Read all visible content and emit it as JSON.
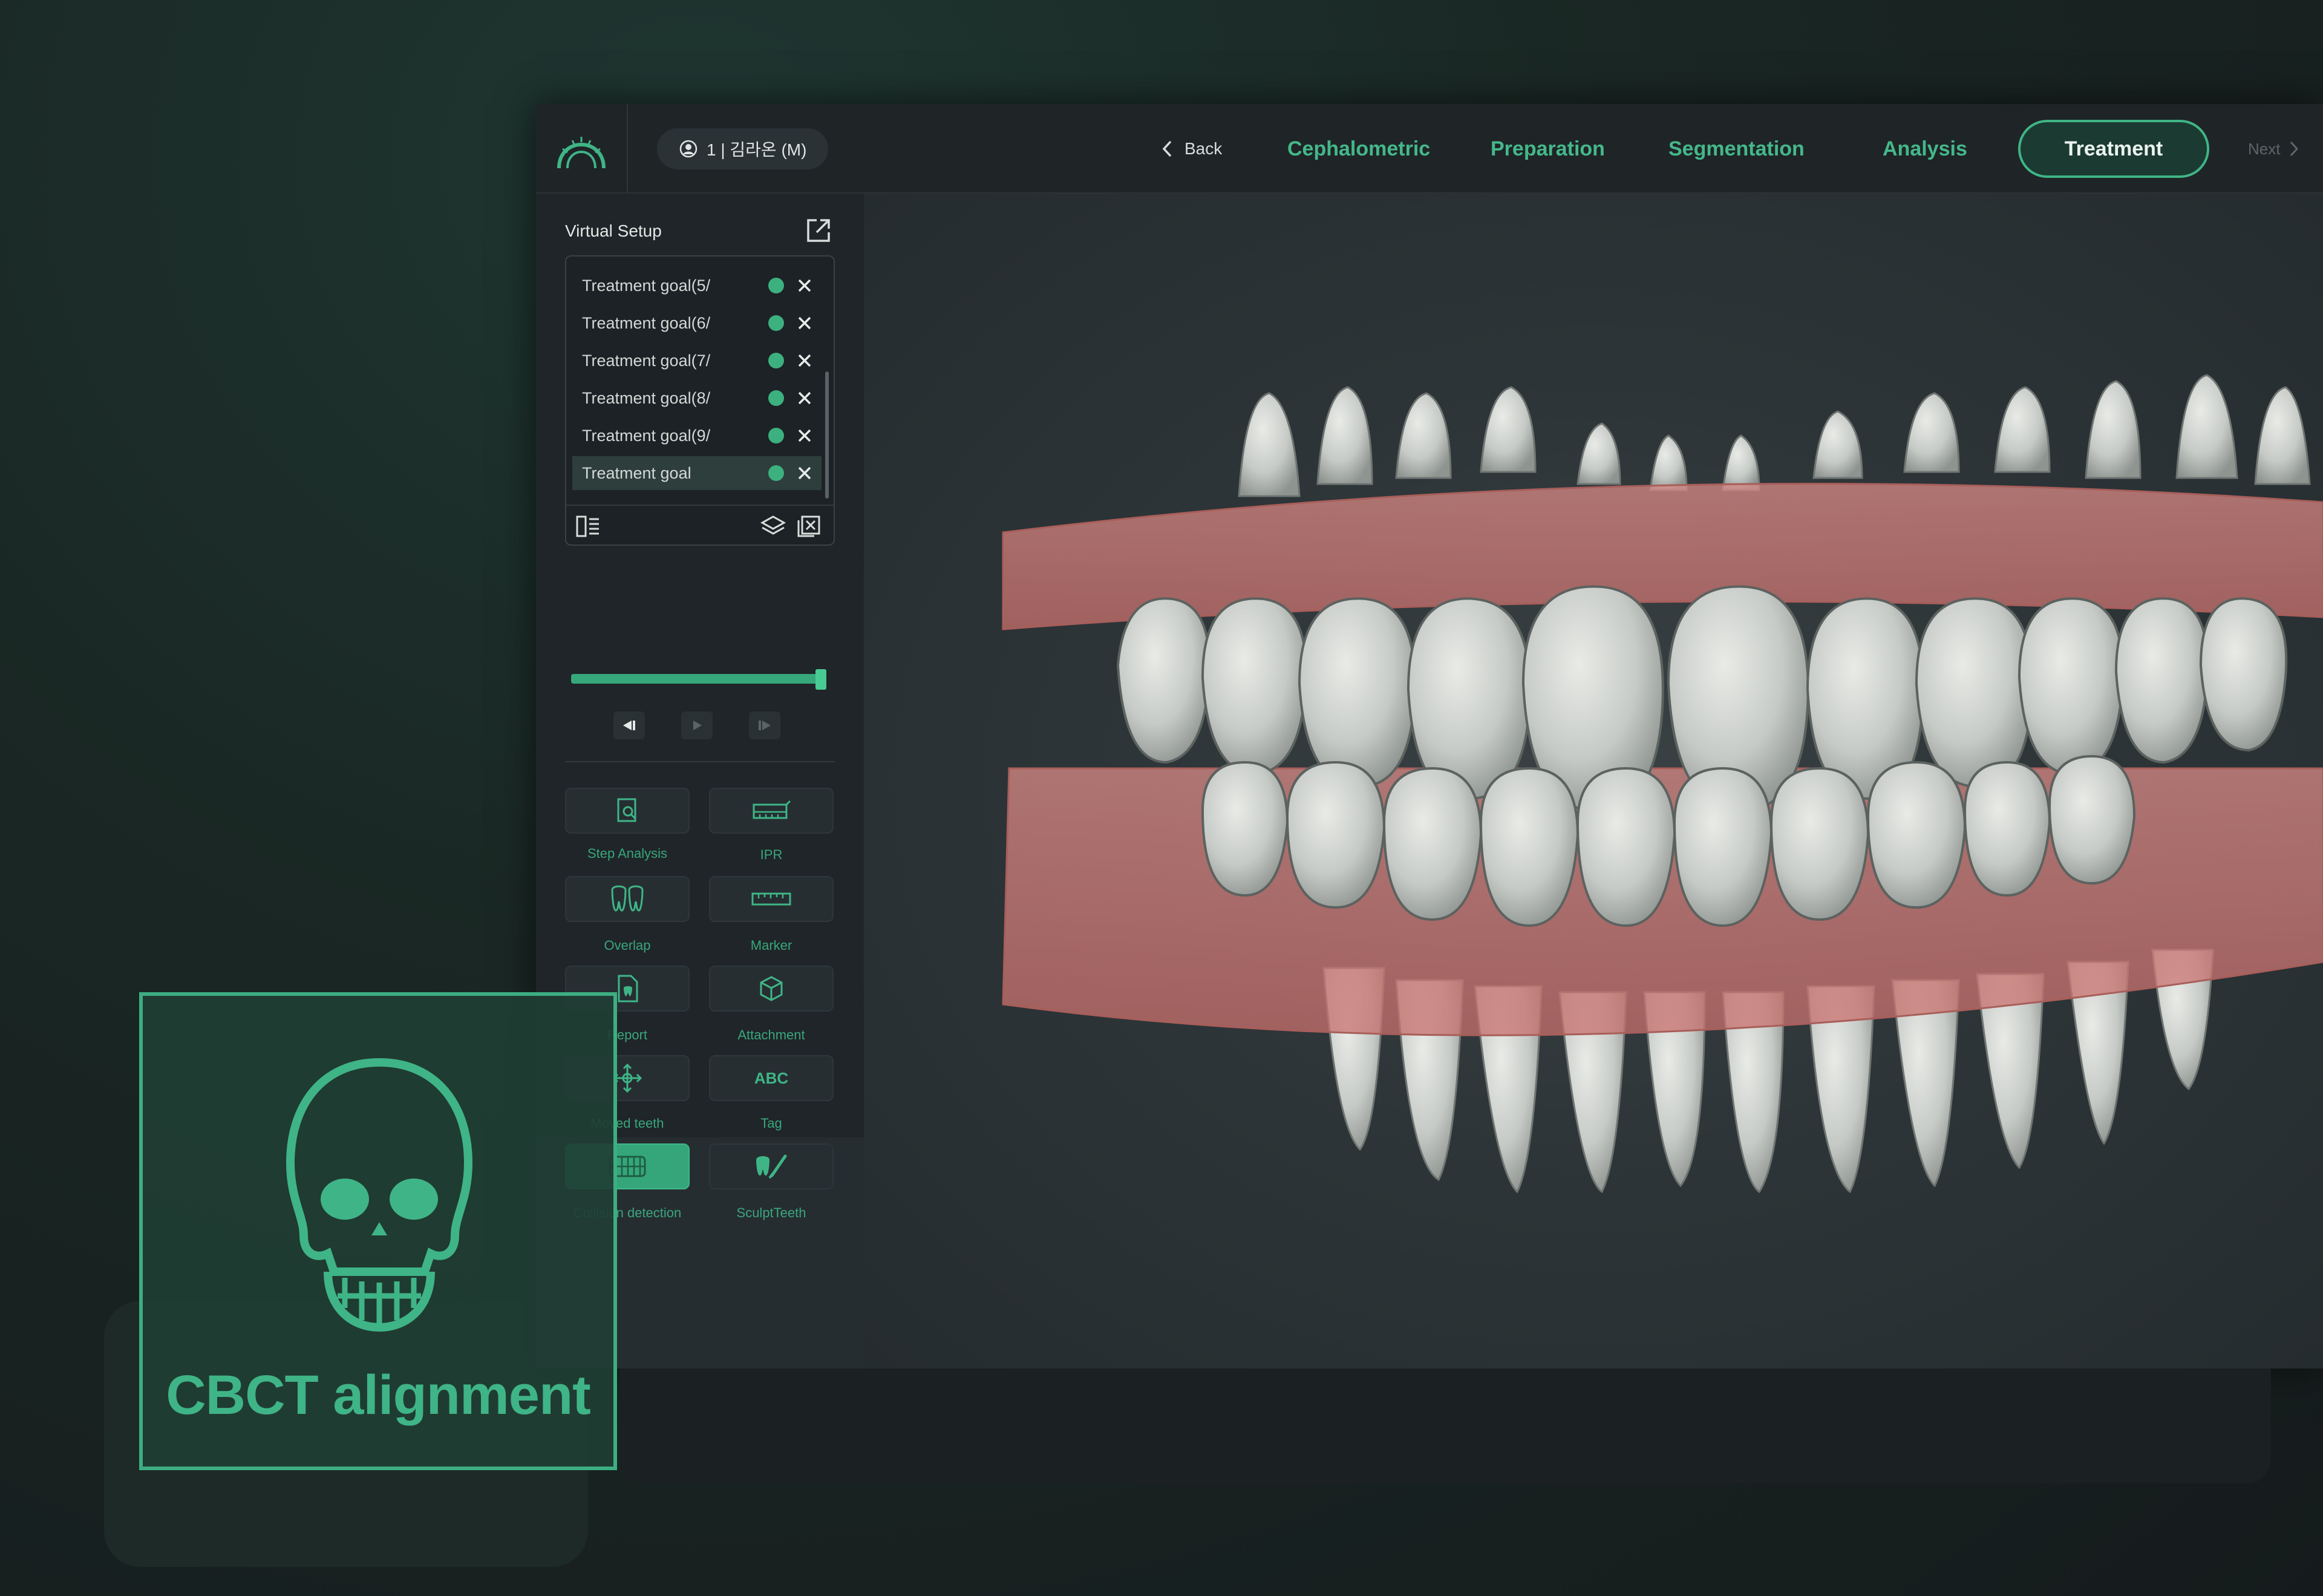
{
  "header": {
    "patient_label": "1 | 김라온 (M)",
    "back_label": "Back",
    "tabs": [
      "Cephalometric",
      "Preparation",
      "Segmentation",
      "Analysis",
      "Treatment"
    ],
    "active_tab": "Treatment",
    "next_label": "Next"
  },
  "panel": {
    "title": "Virtual Setup",
    "goals": [
      {
        "label": "Treatment goal(5/"
      },
      {
        "label": "Treatment goal(6/"
      },
      {
        "label": "Treatment goal(7/"
      },
      {
        "label": "Treatment goal(8/"
      },
      {
        "label": "Treatment goal(9/"
      },
      {
        "label": "Treatment goal"
      }
    ],
    "slider_value": 1.0,
    "tools": [
      {
        "label": "Step Analysis",
        "icon": "magnify-doc-icon"
      },
      {
        "label": "IPR",
        "icon": "ipr-icon"
      },
      {
        "label": "Overlap",
        "icon": "overlap-tooth-icon"
      },
      {
        "label": "Marker",
        "icon": "ruler-icon"
      },
      {
        "label": "Report",
        "icon": "report-icon"
      },
      {
        "label": "Attachment",
        "icon": "cube-icon"
      },
      {
        "label": "Moved teeth",
        "icon": "move-icon"
      },
      {
        "label": "Tag",
        "icon_text": "ABC"
      },
      {
        "label": "Collision detection",
        "icon": "collision-icon"
      },
      {
        "label": "SculptTeeth",
        "icon": "sculpt-icon"
      }
    ]
  },
  "card": {
    "title": "CBCT alignment",
    "icon": "skull-icon"
  },
  "colors": {
    "accent": "#3fb586",
    "gum": "#d9837f",
    "tooth": "#c9ccc8"
  }
}
